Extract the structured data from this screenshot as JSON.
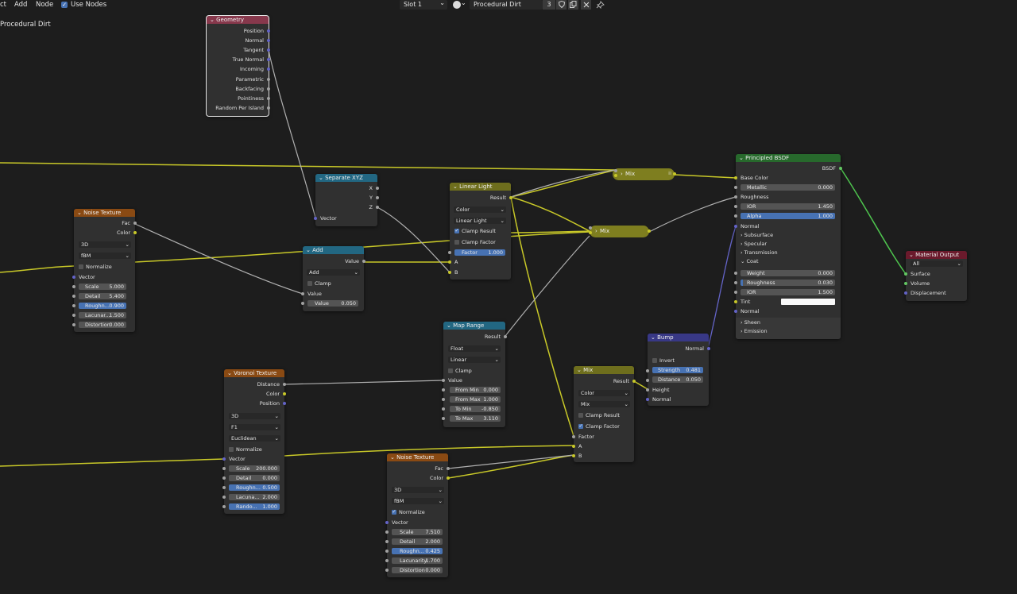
{
  "header": {
    "menu_cut": "ct",
    "add": "Add",
    "node": "Node",
    "use_nodes": "Use Nodes",
    "check": "✓",
    "slot": "Slot 1",
    "material": "Procedural Dirt",
    "user_count": "3",
    "chevron": "⌄",
    "breadcrumb": "Procedural Dirt"
  },
  "colors": {
    "header_input": "#87384c",
    "header_converter": "#226782",
    "header_texture": "#8a4a13",
    "header_shader": "#27692c",
    "header_output": "#6b1a2c",
    "header_color": "#6e6e1d",
    "header_vector": "#383886",
    "socket_vector": "#6363c7",
    "socket_float": "#a1a1a1",
    "socket_color": "#c7c729",
    "socket_shader": "#63c763",
    "wire_yellow": "#c8c828",
    "wire_grey": "#b0b0b0",
    "wire_green": "#4ec54e",
    "wire_blue": "#6464c8"
  },
  "nodes": {
    "geometry": {
      "title": "Geometry",
      "outputs": [
        "Position",
        "Normal",
        "Tangent",
        "True Normal",
        "Incoming",
        "Parametric",
        "Backfacing",
        "Pointiness",
        "Random Per Island"
      ]
    },
    "separate_xyz": {
      "title": "Separate XYZ",
      "outputs": [
        "X",
        "Y",
        "Z"
      ],
      "input": "Vector"
    },
    "noise1": {
      "title": "Noise Texture",
      "out_fac": "Fac",
      "out_color": "Color",
      "dim": "3D",
      "type": "fBM",
      "normalize": "Normalize",
      "vector": "Vector",
      "scale_k": "Scale",
      "scale_v": "5.000",
      "detail_k": "Detail",
      "detail_v": "5.400",
      "rough_k": "Roughn...",
      "rough_v": "0.900",
      "lac_k": "Lacunar...",
      "lac_v": "1.500",
      "dist_k": "Distortion",
      "dist_v": "0.000"
    },
    "add": {
      "title": "Add",
      "out": "Value",
      "op": "Add",
      "clamp": "Clamp",
      "in1": "Value",
      "in2_k": "Value",
      "in2_v": "0.050"
    },
    "linear_light": {
      "title": "Linear Light",
      "out": "Result",
      "dtype": "Color",
      "blend": "Linear Light",
      "clamp_result": "Clamp Result",
      "clamp_factor": "Clamp Factor",
      "factor_k": "Factor",
      "factor_v": "1.000",
      "in_a": "A",
      "in_b": "B"
    },
    "map_range": {
      "title": "Map Range",
      "out": "Result",
      "dtype": "Float",
      "interp": "Linear",
      "clamp": "Clamp",
      "value": "Value",
      "fmin_k": "From Min",
      "fmin_v": "0.000",
      "fmax_k": "From Max",
      "fmax_v": "1.000",
      "tmin_k": "To Min",
      "tmin_v": "-0.850",
      "tmax_k": "To Max",
      "tmax_v": "3.110"
    },
    "voronoi": {
      "title": "Voronoi Texture",
      "out_distance": "Distance",
      "out_color": "Color",
      "out_position": "Position",
      "dim": "3D",
      "feature": "F1",
      "metric": "Euclidean",
      "normalize": "Normalize",
      "vector": "Vector",
      "scale_k": "Scale",
      "scale_v": "200.000",
      "detail_k": "Detail",
      "detail_v": "0.000",
      "rough_k": "Roughn...",
      "rough_v": "0.500",
      "lac_k": "Lacuna...",
      "lac_v": "2.000",
      "rand_k": "Rando...",
      "rand_v": "1.000"
    },
    "noise2": {
      "title": "Noise Texture",
      "out_fac": "Fac",
      "out_color": "Color",
      "dim": "3D",
      "type": "fBM",
      "normalize": "Normalize",
      "vector": "Vector",
      "scale_k": "Scale",
      "scale_v": "7.510",
      "detail_k": "Detail",
      "detail_v": "2.000",
      "rough_k": "Roughn...",
      "rough_v": "0.425",
      "lac_k": "Lacunarity",
      "lac_v": "1.700",
      "dist_k": "Distortion",
      "dist_v": "0.000"
    },
    "mix_node": {
      "title": "Mix",
      "out": "Result",
      "dtype": "Color",
      "blend": "Mix",
      "clamp_result": "Clamp Result",
      "clamp_factor": "Clamp Factor",
      "factor": "Factor",
      "in_a": "A",
      "in_b": "B"
    },
    "mix_reroute_1": {
      "title": "Mix"
    },
    "mix_reroute_2": {
      "title": "Mix"
    },
    "bump": {
      "title": "Bump",
      "out": "Normal",
      "invert": "Invert",
      "strength_k": "Strength",
      "strength_v": "0.481",
      "distance_k": "Distance",
      "distance_v": "0.050",
      "height": "Height",
      "normal": "Normal"
    },
    "bsdf": {
      "title": "Principled BSDF",
      "out": "BSDF",
      "base_color": "Base Color",
      "metallic_k": "Metallic",
      "metallic_v": "0.000",
      "roughness": "Roughness",
      "ior_k": "IOR",
      "ior_v": "1.450",
      "alpha_k": "Alpha",
      "alpha_v": "1.000",
      "normal": "Normal",
      "subsurface": "Subsurface",
      "specular": "Specular",
      "transmission": "Transmission",
      "coat": "Coat",
      "coat_weight_k": "Weight",
      "coat_weight_v": "0.000",
      "coat_rough_k": "Roughness",
      "coat_rough_v": "0.030",
      "coat_ior_k": "IOR",
      "coat_ior_v": "1.500",
      "tint": "Tint",
      "coat_normal": "Normal",
      "sheen": "Sheen",
      "emission": "Emission"
    },
    "material_output": {
      "title": "Material Output",
      "target": "All",
      "surface": "Surface",
      "volume": "Volume",
      "displacement": "Displacement"
    }
  }
}
